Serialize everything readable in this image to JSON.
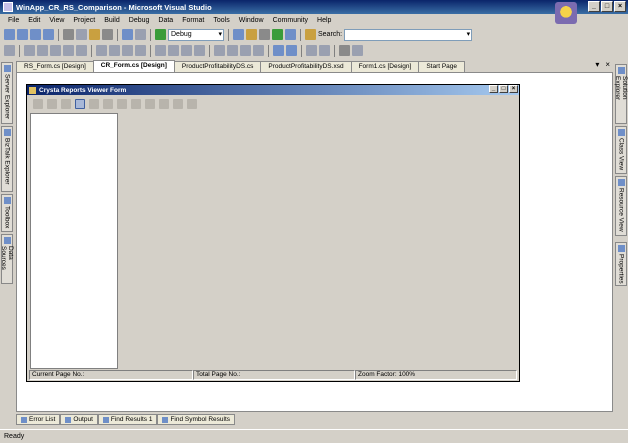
{
  "window": {
    "title": "WinApp_CR_RS_Comparison - Microsoft Visual Studio",
    "controls": [
      "_",
      "□",
      "×"
    ]
  },
  "menu": [
    "File",
    "Edit",
    "View",
    "Project",
    "Build",
    "Debug",
    "Data",
    "Format",
    "Tools",
    "Window",
    "Community",
    "Help"
  ],
  "toolbar": {
    "config_value": "Debug",
    "search_label": "Search:",
    "search_value": ""
  },
  "left_panels": [
    "Server Explorer",
    "BizTalk Explorer",
    "Toolbox",
    "Data Sources"
  ],
  "right_panels": [
    "Solution Explorer",
    "Class View",
    "Resource View",
    "Properties"
  ],
  "doc_tabs": [
    {
      "label": "RS_Form.cs [Design]",
      "active": false
    },
    {
      "label": "CR_Form.cs [Design]",
      "active": true
    },
    {
      "label": "ProductProfitabilityDS.cs",
      "active": false
    },
    {
      "label": "ProductProfitabilityDS.xsd",
      "active": false
    },
    {
      "label": "Form1.cs [Design]",
      "active": false
    },
    {
      "label": "Start Page",
      "active": false
    }
  ],
  "doc_controls": {
    "dropdown": "▾",
    "close": "×"
  },
  "form": {
    "title": "Crysta Reports Viewer Form",
    "status": {
      "current_page": "Current Page No.:",
      "total_page": "Total Page No.:",
      "zoom": "Zoom Factor: 100%"
    }
  },
  "bottom_tabs": [
    "Error List",
    "Output",
    "Find Results 1",
    "Find Symbol Results"
  ],
  "status_text": "Ready"
}
